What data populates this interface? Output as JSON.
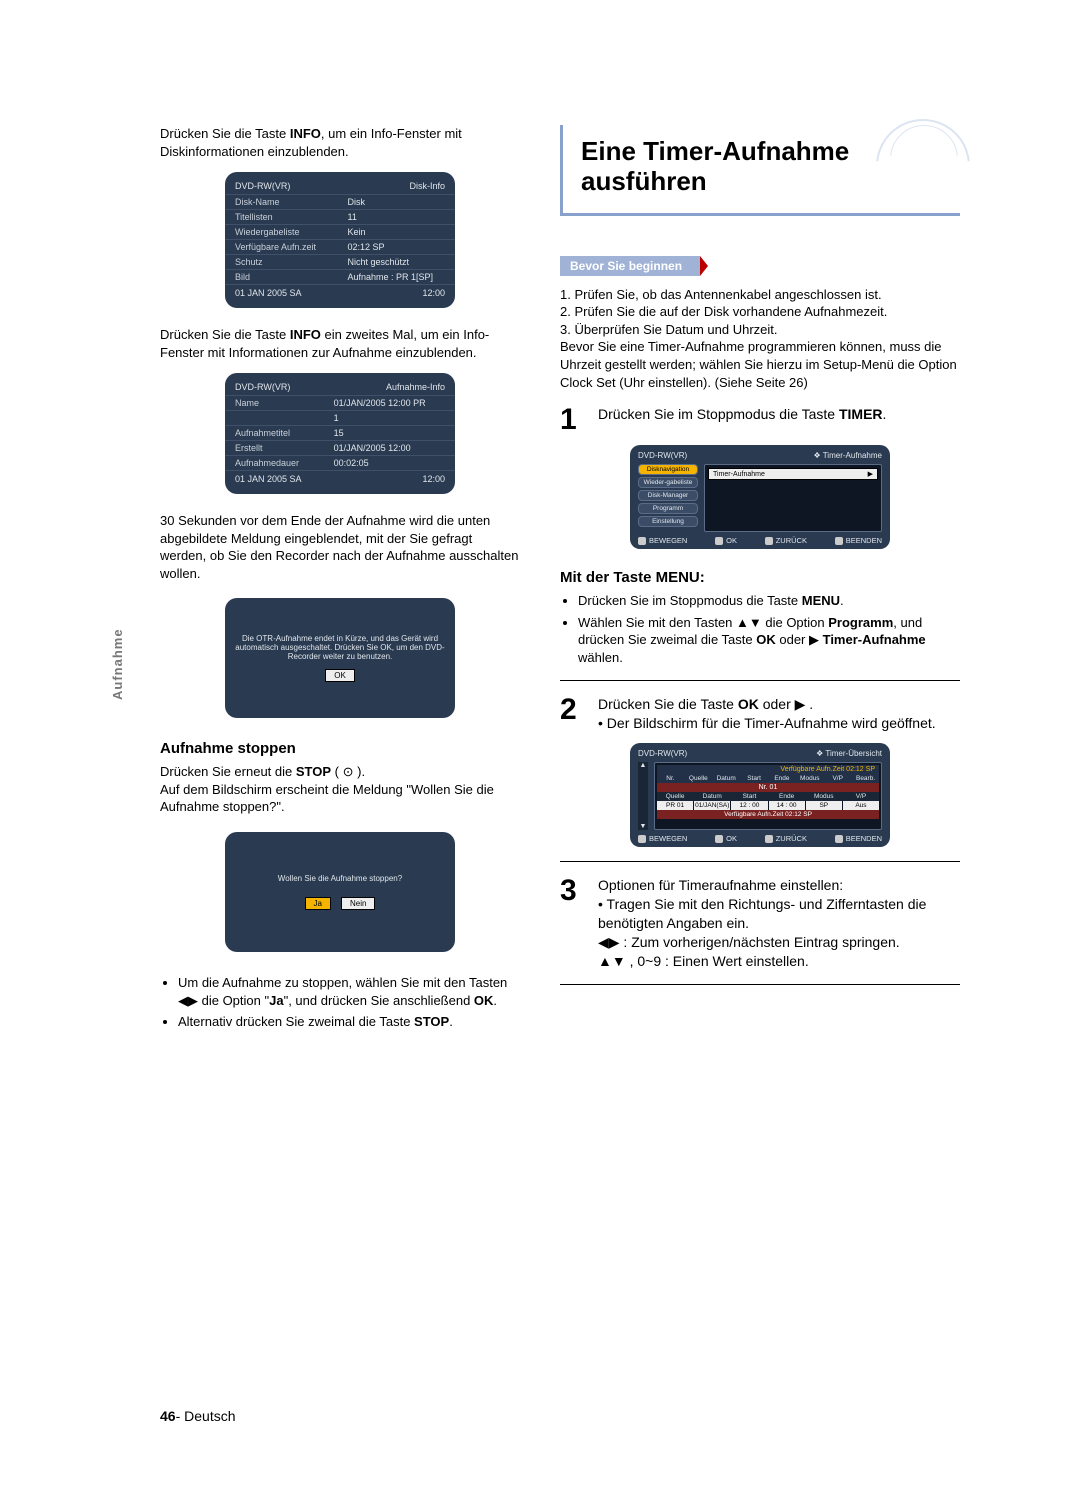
{
  "side_label": "Aufnahme",
  "left": {
    "intro1a": "Drücken Sie die Taste ",
    "intro1b": "INFO",
    "intro1c": ", um ein Info-Fenster mit Diskinformationen einzublenden.",
    "osd1": {
      "mode": "DVD-RW(VR)",
      "title": "Disk-Info",
      "rows": [
        [
          "Disk-Name",
          "Disk"
        ],
        [
          "Titellisten",
          "11"
        ],
        [
          "Wiedergabeliste",
          "Kein"
        ],
        [
          "Verfügbare Aufn.zeit",
          "02:12 SP"
        ],
        [
          "Schutz",
          "Nicht geschützt"
        ],
        [
          "Bild",
          "Aufnahme :  PR 1[SP]"
        ]
      ],
      "foot_l": "01 JAN 2005 SA",
      "foot_r": "12:00"
    },
    "intro2a": "Drücken Sie die Taste ",
    "intro2b": "INFO",
    "intro2c": " ein zweites Mal, um ein Info-Fenster mit Informationen zur Aufnahme einzublenden.",
    "osd2": {
      "mode": "DVD-RW(VR)",
      "title": "Aufnahme-Info",
      "rows": [
        [
          "Name",
          "01/JAN/2005 12:00 PR"
        ],
        [
          "",
          "1"
        ],
        [
          "Aufnahmetitel",
          "15"
        ],
        [
          "Erstellt",
          "01/JAN/2005 12:00"
        ],
        [
          "Aufnahmedauer",
          "00:02:05"
        ]
      ],
      "foot_l": "01 JAN 2005 SA",
      "foot_r": "12:00"
    },
    "p30": "30 Sekunden vor dem Ende der Aufnahme wird die unten abgebildete Meldung eingeblendet, mit der Sie gefragt werden, ob Sie den Recorder nach der Aufnahme ausschalten wollen.",
    "otr_msg": "Die OTR-Aufnahme endet in Kürze, und das Gerät wird automatisch ausgeschaltet. Drücken Sie OK, um den DVD-Recorder weiter zu benutzen.",
    "otr_ok": "OK",
    "h_stop": "Aufnahme stoppen",
    "stop_a": "Drücken Sie erneut die ",
    "stop_b": "STOP",
    "stop_c": " ( ",
    "stop_d": " ).",
    "stop_line2": "Auf dem Bildschirm erscheint die Meldung \"Wollen Sie die Aufnahme stoppen?\".",
    "stop_msg": "Wollen Sie die Aufnahme stoppen?",
    "btn_yes": "Ja",
    "btn_no": "Nein",
    "bullet1a": "Um die Aufnahme zu stoppen, wählen Sie mit den Tasten ◀▶ die Option \"",
    "bullet1b": "Ja",
    "bullet1c": "\", und drücken Sie anschließend ",
    "bullet1d": "OK",
    "bullet1e": ".",
    "bullet2a": "Alternativ drücken Sie zweimal die Taste ",
    "bullet2b": "STOP",
    "bullet2c": "."
  },
  "right": {
    "title": "Eine Timer-Aufnahme ausführen",
    "before": "Bevor Sie beginnen",
    "pre": [
      "1. Prüfen Sie, ob das Antennenkabel angeschlossen ist.",
      "2. Prüfen Sie die auf der Disk vorhandene Aufnahmezeit.",
      "3. Überprüfen Sie Datum und Uhrzeit."
    ],
    "pre_note": "Bevor Sie eine Timer-Aufnahme programmieren können, muss die Uhrzeit gestellt werden; wählen Sie hierzu im Setup-Menü die Option Clock Set (Uhr einstellen). (Siehe Seite 26)",
    "s1a": "Drücken Sie im Stoppmodus die Taste ",
    "s1b": "TIMER",
    "s1c": ".",
    "menu_osd": {
      "mode": "DVD-RW(VR)",
      "title_icon": "❖",
      "title": "Timer-Aufnahme",
      "side": [
        "Disknavigation",
        "Wieder-gabeliste",
        "Disk-Manager",
        "Programm",
        "Einstellung"
      ],
      "main_row": "Timer-Aufnahme",
      "arrow": "▶",
      "ft": {
        "move": "BEWEGEN",
        "ok": "OK",
        "back": "ZURÜCK",
        "exit": "BEENDEN"
      }
    },
    "h_menu": "Mit der Taste MENU:",
    "m1a": "Drücken Sie im Stoppmodus die Taste ",
    "m1b": "MENU",
    "m1c": ".",
    "m2a": "Wählen Sie mit den Tasten ▲▼ die Option ",
    "m2b": "Programm",
    "m2c": ", und drücken Sie zweimal die Taste ",
    "m2d": "OK",
    "m2e": " oder ▶ ",
    "m2f": "Timer-Aufnahme",
    "m2g": " wählen.",
    "s2a": "Drücken Sie die Taste ",
    "s2b": "OK",
    "s2c": " oder ▶ .",
    "s2note": "• Der Bildschirm für die Timer-Aufnahme wird geöffnet.",
    "table_osd": {
      "mode": "DVD-RW(VR)",
      "title": "Timer-Übersicht",
      "avail": "Verfügbare Aufn.Zeit 02:12 SP",
      "hdr": [
        "Nr.",
        "Quelle",
        "Datum",
        "Start",
        "Ende",
        "Modus",
        "V/P",
        "Bearb."
      ],
      "redhdr": "Nr. 01",
      "row2hdr": [
        "Quelle",
        "Datum",
        "Start",
        "Ende",
        "Modus",
        "V/P"
      ],
      "row2": [
        "PR 01",
        "01/JAN(SA)",
        "12 : 00",
        "14 : 00",
        "SP",
        "Aus"
      ],
      "redfoot": "Verfügbare Aufn.Zeit 02:12 SP",
      "ft": {
        "move": "BEWEGEN",
        "ok": "OK",
        "back": "ZURÜCK",
        "exit": "BEENDEN"
      }
    },
    "s3a": "Optionen für Timeraufnahme einstellen:",
    "s3note": "• Tragen Sie mit den Richtungs- und Zifferntasten die benötigten Angaben ein.",
    "s3l1": "◀▶ : Zum vorherigen/nächsten Eintrag springen.",
    "s3l2": "▲▼ , 0~9 : Einen Wert einstellen."
  },
  "footer": {
    "page": "46",
    "sep": "- ",
    "lang": "Deutsch"
  }
}
